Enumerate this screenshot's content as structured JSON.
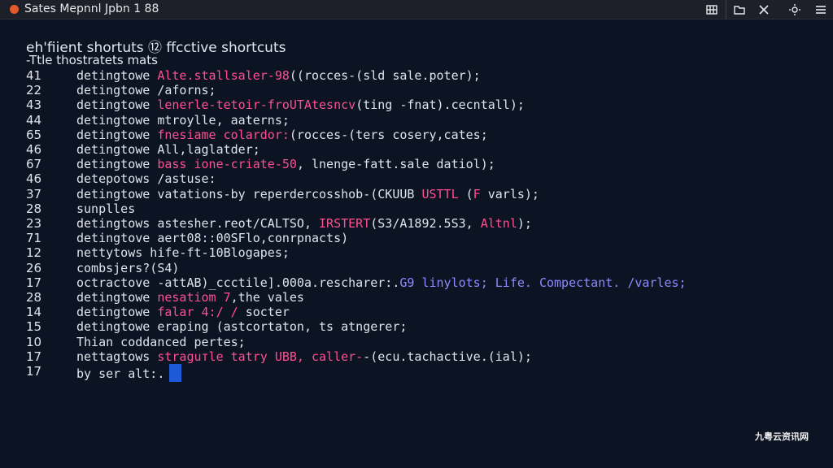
{
  "window": {
    "title": "Sates Mepnnl Jpbn 1 88",
    "accent": "#e25a2c",
    "background": "#0c1424"
  },
  "toolbar": {
    "buttons": [
      {
        "icon": "grid-table-icon"
      },
      {
        "icon": "folder-icon"
      },
      {
        "icon": "tools-icon"
      },
      {
        "icon": "sun-settings-icon"
      },
      {
        "icon": "hamburger-menu-icon"
      },
      {
        "icon": "close-icon"
      }
    ]
  },
  "editor": {
    "heading": "eh'fiient shortuts ⑫ ffcctive shortcuts",
    "subheading": "-Ttle thostratets mats",
    "lines": [
      {
        "num": "41",
        "parts": [
          {
            "t": "detingtowe ",
            "c": "white"
          },
          {
            "t": "Alte.stallsaler-98",
            "c": "pink"
          },
          {
            "t": "((rocces-(sld sale.poter);",
            "c": "white"
          }
        ]
      },
      {
        "num": "22",
        "parts": [
          {
            "t": "detingtowe /aforns;",
            "c": "white"
          }
        ]
      },
      {
        "num": "43",
        "parts": [
          {
            "t": "detingtowe ",
            "c": "white"
          },
          {
            "t": "lenerle-tetoir-froUTAtesncv",
            "c": "pink"
          },
          {
            "t": "(ting -fnat).cecntall);",
            "c": "white"
          }
        ]
      },
      {
        "num": "44",
        "parts": [
          {
            "t": "detingtowe mtroylle, aaterns;",
            "c": "white"
          }
        ]
      },
      {
        "num": "65",
        "parts": [
          {
            "t": "detingtowe ",
            "c": "white"
          },
          {
            "t": "fnesiame colardor:",
            "c": "pink"
          },
          {
            "t": "(rocces-(ters cosery,cates;",
            "c": "white"
          }
        ]
      },
      {
        "num": "46",
        "parts": [
          {
            "t": "detingtowe All,laglatder;",
            "c": "white"
          }
        ]
      },
      {
        "num": "67",
        "parts": [
          {
            "t": "detingtowe ",
            "c": "white"
          },
          {
            "t": "bass ione-criate-50",
            "c": "pink"
          },
          {
            "t": ", lnenge-fatt.sale datiol);",
            "c": "white"
          }
        ]
      },
      {
        "num": "46",
        "parts": [
          {
            "t": "detepotows /astuse:",
            "c": "white"
          }
        ]
      },
      {
        "num": "37",
        "parts": [
          {
            "t": "detingtowe vatations-by reperdercosshob-(CKUUB ",
            "c": "white"
          },
          {
            "t": "USTTL",
            "c": "pink"
          },
          {
            "t": " (",
            "c": "white"
          },
          {
            "t": "F",
            "c": "pink"
          },
          {
            "t": " varls);",
            "c": "white"
          }
        ]
      },
      {
        "num": "28",
        "parts": [
          {
            "t": "sunplles",
            "c": "white"
          }
        ]
      },
      {
        "num": "23",
        "parts": [
          {
            "t": "detingtows astesher.reot/CALTSO, ",
            "c": "white"
          },
          {
            "t": "IRSTERT",
            "c": "pink"
          },
          {
            "t": "(S3/A1892.5S3, ",
            "c": "white"
          },
          {
            "t": "Altnl",
            "c": "pink"
          },
          {
            "t": ");",
            "c": "white"
          }
        ]
      },
      {
        "num": "71",
        "parts": [
          {
            "t": "detingtove aert08::00SFlo,conrpnacts)",
            "c": "white"
          }
        ]
      },
      {
        "num": "12",
        "parts": [
          {
            "t": "nettytows hife-ft-10Blogapes;",
            "c": "white"
          }
        ]
      },
      {
        "num": "26",
        "parts": [
          {
            "t": "  combsjers?(S4)",
            "c": "white"
          }
        ]
      },
      {
        "num": "17",
        "parts": [
          {
            "t": "octractove -attAB)_ccctile].000a.rescharer:.",
            "c": "white"
          },
          {
            "t": "G9 linylots; Life. Compectant. /varles;",
            "c": "blue"
          }
        ]
      },
      {
        "num": "28",
        "parts": [
          {
            "t": "detingtowe ",
            "c": "white"
          },
          {
            "t": "nesatiom 7",
            "c": "pink"
          },
          {
            "t": ",the vales",
            "c": "white"
          }
        ]
      },
      {
        "num": "14",
        "parts": [
          {
            "t": "detingtowe ",
            "c": "white"
          },
          {
            "t": "falar 4:/ /",
            "c": "pink"
          },
          {
            "t": " socter",
            "c": "white"
          }
        ]
      },
      {
        "num": "15",
        "parts": [
          {
            "t": "detingtowe eraping (astcortaton, ts atngerer;",
            "c": "white"
          }
        ]
      },
      {
        "num": "10",
        "parts": [
          {
            "t": "Thian coddanced pertes;",
            "c": "white"
          }
        ]
      },
      {
        "num": "17",
        "parts": [
          {
            "t": "nettagtows ",
            "c": "white"
          },
          {
            "t": "straguтle tatry UBB, caller-",
            "c": "pink"
          },
          {
            "t": "-(ecu.tachactive.(ial);",
            "c": "white"
          }
        ]
      },
      {
        "num": "17",
        "parts": [
          {
            "t": "by ser alt:.",
            "c": "white"
          }
        ],
        "cursor": true
      }
    ]
  },
  "watermark": "九粤云资讯网"
}
